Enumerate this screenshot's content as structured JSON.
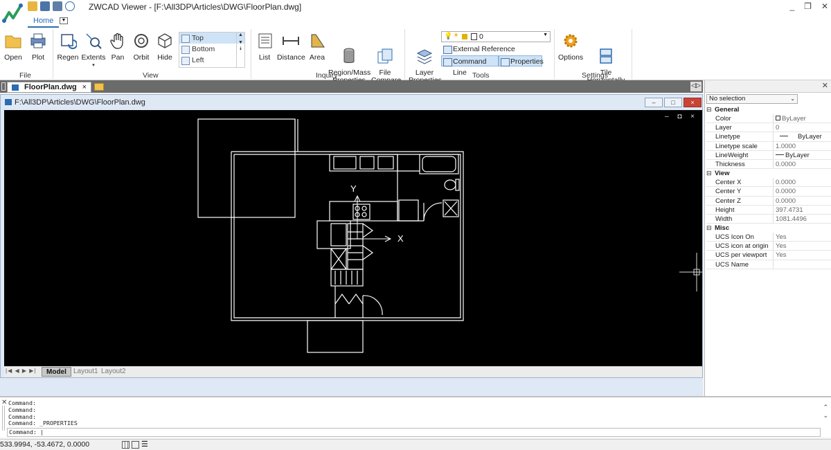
{
  "window": {
    "title": "ZWCAD Viewer - [F:\\All3DP\\Articles\\DWG\\FloorPlan.dwg]"
  },
  "ribbon": {
    "tabs": [
      {
        "label": "Home",
        "active": true
      }
    ],
    "groups": {
      "file": {
        "label": "File",
        "buttons": [
          "Open",
          "Plot"
        ]
      },
      "view": {
        "label": "View",
        "buttons": [
          "Regen",
          "Extents",
          "Pan",
          "Orbit",
          "Hide"
        ],
        "views": [
          "Top",
          "Bottom",
          "Left"
        ],
        "selected_view": "Top"
      },
      "inquiry": {
        "label": "Inquiry",
        "buttons": [
          "List",
          "Distance",
          "Area",
          "Region/Mass\nProperties",
          "File\nCompare"
        ]
      },
      "tools": {
        "label": "Tools",
        "layer_properties": "Layer\nProperties",
        "layer_value": "0",
        "external_reference": "External Reference",
        "command_line": "Command Line",
        "properties": "Properties"
      },
      "settings": {
        "label": "Settings",
        "buttons": [
          "Options",
          "Tile\nHorizontally"
        ]
      }
    }
  },
  "document_tab": {
    "label": "FloorPlan.dwg",
    "close": "×"
  },
  "drawing_window": {
    "title": "F:\\All3DP\\Articles\\DWG\\FloorPlan.dwg",
    "controls": [
      "–",
      "□",
      "×"
    ],
    "canvas_controls": "– ◘ ×",
    "axis_labels": {
      "x": "X",
      "y": "Y"
    },
    "layout_tabs": [
      {
        "label": "Model",
        "active": true
      },
      {
        "label": "Layout1",
        "active": false
      },
      {
        "label": "Layout2",
        "active": false
      }
    ]
  },
  "properties_panel": {
    "selection": "No selection",
    "categories": [
      {
        "name": "General",
        "rows": [
          {
            "key": "Color",
            "value": "ByLayer"
          },
          {
            "key": "Layer",
            "value": "0"
          },
          {
            "key": "Linetype",
            "value": "ByLayer"
          },
          {
            "key": "Linetype scale",
            "value": "1.0000"
          },
          {
            "key": "LineWeight",
            "value": "ByLayer"
          },
          {
            "key": "Thickness",
            "value": "0.0000"
          }
        ]
      },
      {
        "name": "View",
        "rows": [
          {
            "key": "Center X",
            "value": "0.0000"
          },
          {
            "key": "Center Y",
            "value": "0.0000"
          },
          {
            "key": "Center Z",
            "value": "0.0000"
          },
          {
            "key": "Height",
            "value": "397.4731"
          },
          {
            "key": "Width",
            "value": "1081.4496"
          }
        ]
      },
      {
        "name": "Misc",
        "rows": [
          {
            "key": "UCS Icon On",
            "value": "Yes"
          },
          {
            "key": "UCS icon at origin",
            "value": "Yes"
          },
          {
            "key": "UCS per viewport",
            "value": "Yes"
          },
          {
            "key": "UCS Name",
            "value": ""
          }
        ]
      }
    ]
  },
  "command": {
    "history": [
      "Command:",
      "Command:",
      "Command:",
      "Command: _PROPERTIES"
    ],
    "prompt": "Command: |"
  },
  "status_bar": {
    "coordinates": "533.9994, -53.4672, 0.0000"
  },
  "colors": {
    "accent": "#2b6cb0",
    "canvas": "#000000",
    "drawing_line": "#ffffff"
  }
}
